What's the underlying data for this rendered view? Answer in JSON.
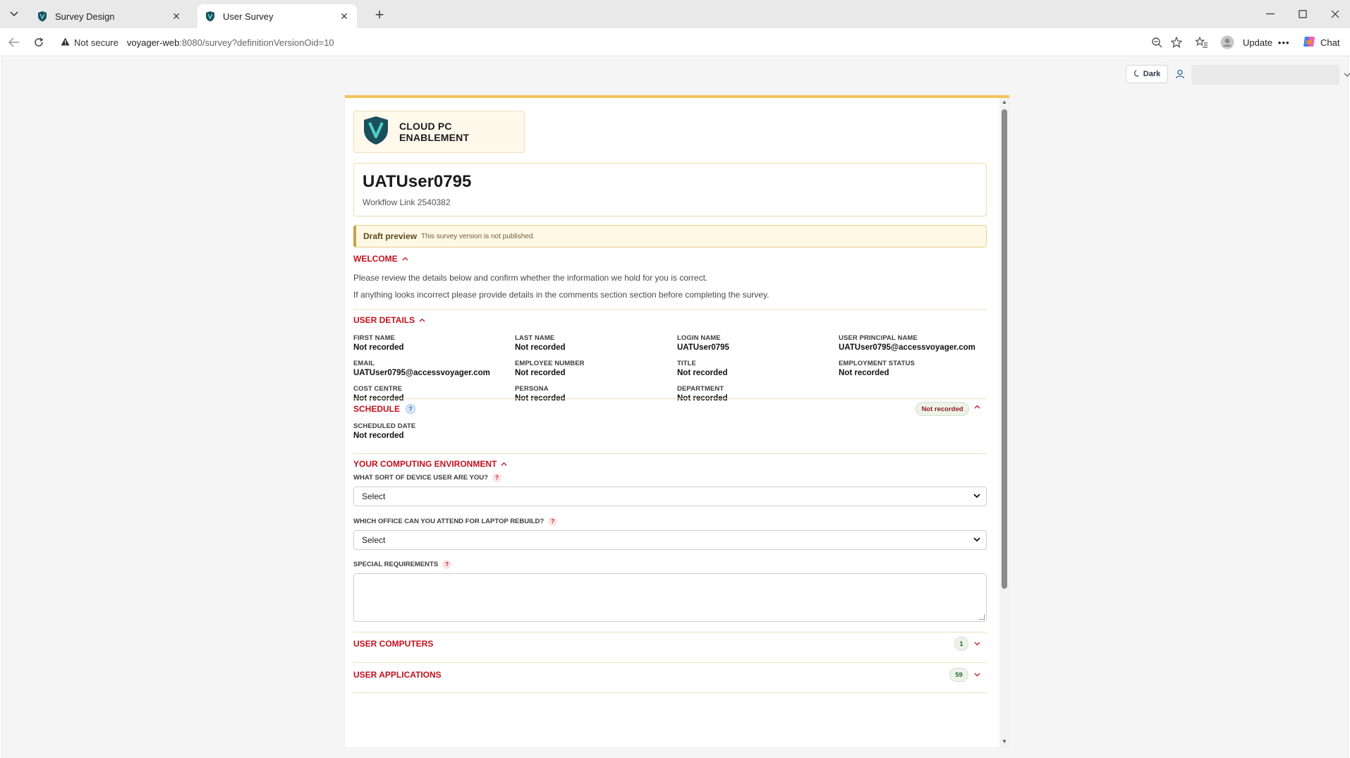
{
  "browser": {
    "tabs": [
      {
        "title": "Survey Design"
      },
      {
        "title": "User Survey"
      }
    ],
    "security_label": "Not secure",
    "url_host": "voyager-web",
    "url_rest": ":8080/survey?definitionVersionOid=10",
    "update_label": "Update",
    "chat_label": "Chat"
  },
  "header": {
    "dark_label": "Dark",
    "user_select_value": ""
  },
  "survey": {
    "brand_text": "CLOUD PC ENABLEMENT",
    "user_name": "UATUser0795",
    "workflow": "Workflow Link 2540382",
    "draft_title": "Draft preview",
    "draft_note": "This survey version is not published.",
    "welcome": {
      "heading": "WELCOME",
      "line1": "Please review the details below and confirm whether the information we hold for you is correct.",
      "line2": "If anything looks incorrect please provide details in the comments section section before completing the survey."
    },
    "user_details": {
      "heading": "USER DETAILS",
      "fields": [
        {
          "label": "FIRST NAME",
          "value": "Not recorded"
        },
        {
          "label": "LAST NAME",
          "value": "Not recorded"
        },
        {
          "label": "LOGIN NAME",
          "value": "UATUser0795"
        },
        {
          "label": "USER PRINCIPAL NAME",
          "value": "UATUser0795@accessvoyager.com"
        },
        {
          "label": "EMAIL",
          "value": "UATUser0795@accessvoyager.com"
        },
        {
          "label": "EMPLOYEE NUMBER",
          "value": "Not recorded"
        },
        {
          "label": "TITLE",
          "value": "Not recorded"
        },
        {
          "label": "EMPLOYMENT STATUS",
          "value": "Not recorded"
        },
        {
          "label": "COST CENTRE",
          "value": "Not recorded"
        },
        {
          "label": "PERSONA",
          "value": "Not recorded"
        },
        {
          "label": "DEPARTMENT",
          "value": "Not recorded"
        }
      ]
    },
    "schedule": {
      "heading": "SCHEDULE",
      "help": "?",
      "badge": "Not recorded",
      "field_label": "SCHEDULED DATE",
      "field_value": "Not recorded"
    },
    "environment": {
      "heading": "YOUR COMPUTING ENVIRONMENT",
      "q1_label": "WHAT SORT OF DEVICE USER ARE YOU?",
      "q1_value": "Select",
      "q2_label": "WHICH OFFICE CAN YOU ATTEND FOR LAPTOP REBUILD?",
      "q2_value": "Select",
      "q3_label": "SPECIAL REQUIREMENTS",
      "help": "?"
    },
    "user_computers": {
      "heading": "USER COMPUTERS",
      "count": "1"
    },
    "user_applications": {
      "heading": "USER APPLICATIONS",
      "count": "59"
    }
  },
  "colors": {
    "section_red": "#c1121f",
    "accent_gold": "#f2c55c",
    "logo_teal": "#1b4f5c"
  }
}
